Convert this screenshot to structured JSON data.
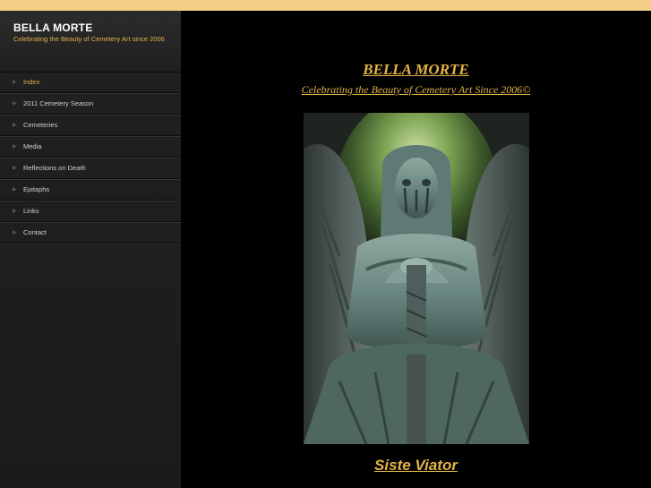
{
  "sidebar": {
    "title": "BELLA MORTE",
    "tagline": "Celebrating the Beauty of Cemetery Art since 2006",
    "nav": [
      {
        "label": "Index",
        "active": true
      },
      {
        "label": "2011 Cemetery Season"
      },
      {
        "label": "Cemeteries"
      },
      {
        "label": "Media"
      },
      {
        "label": "Reflections on Death"
      },
      {
        "label": "Epitaphs"
      },
      {
        "label": "Links"
      },
      {
        "label": "Contact"
      }
    ]
  },
  "main": {
    "title": "BELLA MORTE",
    "subtitle": "Celebrating the Beauty of Cemetery Art Since 2006©",
    "caption": "Siste Viator"
  },
  "colors": {
    "accent": "#e3b345",
    "top_bar": "#f2cf84",
    "sidebar_bg": "#202020",
    "main_bg": "#000000"
  },
  "icons": {
    "nav_bullet": "triangle-right-icon"
  }
}
